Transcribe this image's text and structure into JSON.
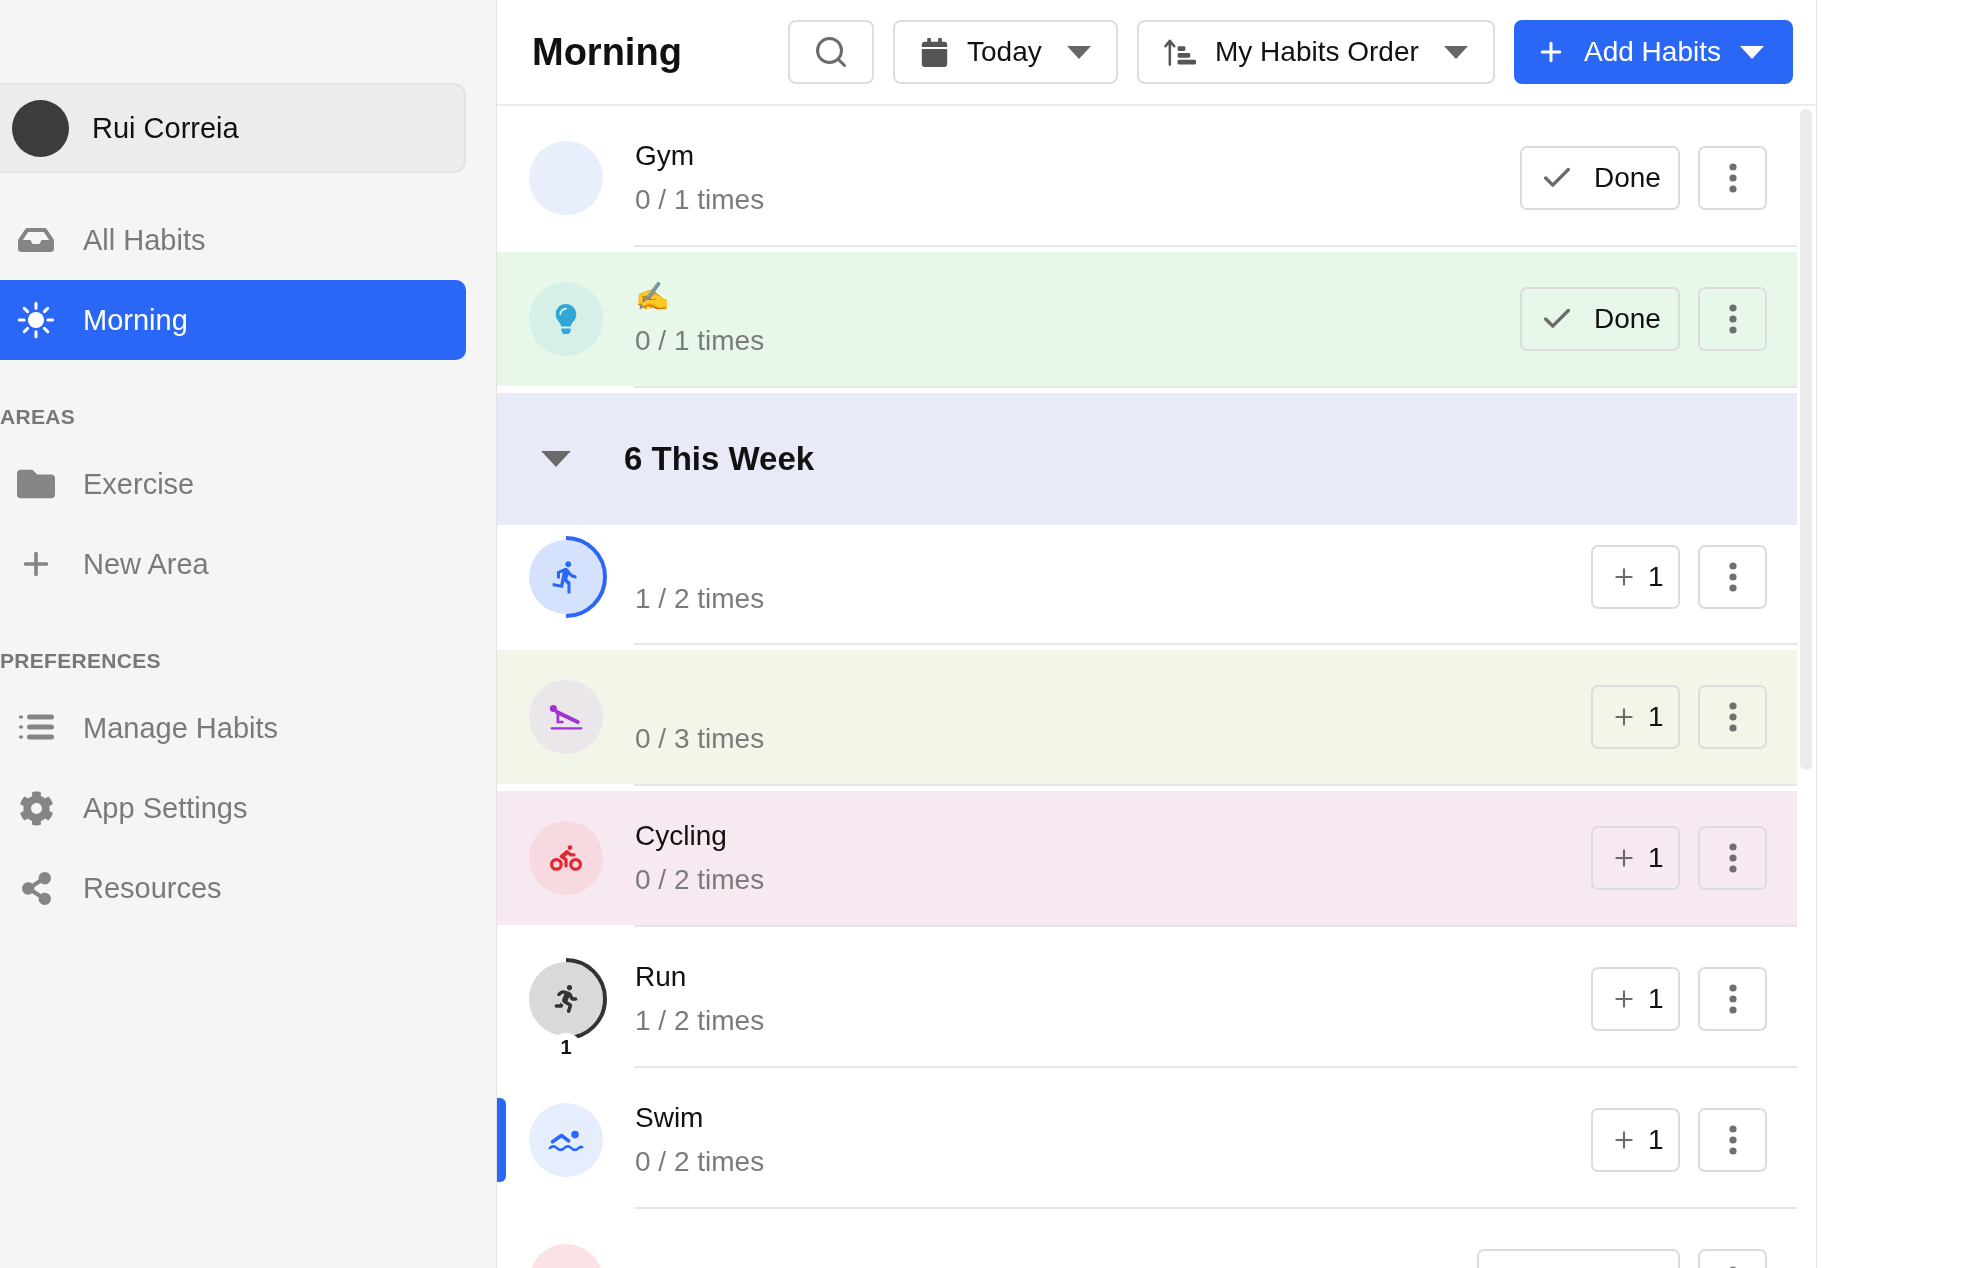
{
  "sidebar": {
    "profile": {
      "name": "Rui Correia"
    },
    "nav": [
      {
        "label": "All Habits",
        "selected": false
      },
      {
        "label": "Morning",
        "selected": true
      }
    ],
    "sections": [
      {
        "heading": "AREAS",
        "items": [
          {
            "label": "Exercise",
            "selected": false
          },
          {
            "label": "New Area",
            "selected": false
          }
        ]
      },
      {
        "heading": "PREFERENCES",
        "items": [
          {
            "label": "Manage Habits",
            "selected": false
          },
          {
            "label": "App Settings",
            "selected": false
          },
          {
            "label": "Resources",
            "selected": false
          }
        ]
      }
    ]
  },
  "header": {
    "title": "Morning",
    "date_filter": {
      "label": "Today"
    },
    "sort": {
      "label": "My Habits Order"
    },
    "add_button": {
      "label": "Add Habits"
    }
  },
  "habits_today": [
    {
      "title": "Gym",
      "progress": "0 / 1 times",
      "color": "#e9eefd",
      "action": {
        "kind": "done",
        "label": "Done"
      },
      "selected": false
    },
    {
      "title": "✍",
      "progress": "0 / 1 times",
      "color": "#d7f0e7",
      "icon": {
        "color": "#2fa7d8"
      },
      "tint": {
        "color": "#e7f7ea"
      },
      "action": {
        "kind": "done",
        "label": "Done"
      },
      "selected": false
    }
  ],
  "group": {
    "label": "6 This Week",
    "expanded": true
  },
  "habits_week": [
    {
      "progress": "1 / 2 times",
      "color": "#d5e2fd",
      "icon": {
        "color": "#2b67f6"
      },
      "level": 0.5,
      "action": {
        "kind": "count",
        "label": "1"
      },
      "selected": false
    },
    {
      "progress": "0 / 3 times",
      "color": "#ebe6ea",
      "icon": {
        "color": "#a033d1"
      },
      "tint": {
        "color": "#f2f6e9"
      },
      "action": {
        "kind": "count",
        "label": "1"
      },
      "selected": false
    },
    {
      "title": "Cycling",
      "progress": "0 / 2 times",
      "color": "#f7d9e0",
      "icon": {
        "color": "#e0282e"
      },
      "tint": {
        "color": "#f7e9f1"
      },
      "action": {
        "kind": "count",
        "label": "1"
      },
      "selected": false
    },
    {
      "title": "Run",
      "progress": "1 / 2 times",
      "color": "#d9d9d9",
      "icon": {
        "color": "#333333"
      },
      "level": 0.5,
      "streak": "1",
      "action": {
        "kind": "count",
        "label": "1"
      },
      "selected": false
    },
    {
      "title": "Swim",
      "progress": "0 / 2 times",
      "color": "#e6eefd",
      "icon": {
        "color": "#2b67f6"
      },
      "action": {
        "kind": "count",
        "label": "1"
      },
      "selected": true
    },
    {
      "color": "#fbe3e5",
      "action": {
        "kind": "blank"
      },
      "selected": false
    }
  ]
}
